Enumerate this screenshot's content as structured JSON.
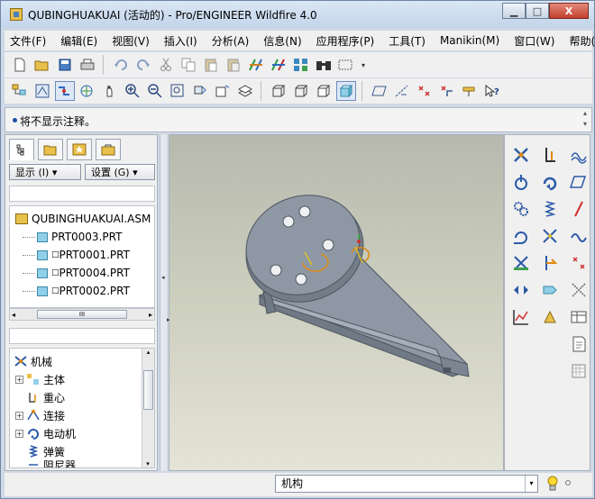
{
  "window": {
    "title": "QUBINGHUAKUAI (活动的) - Pro/ENGINEER Wildfire 4.0",
    "min_glyph": "▁",
    "max_glyph": "□",
    "close_glyph": "X"
  },
  "menu": [
    "文件(F)",
    "编辑(E)",
    "视图(V)",
    "插入(I)",
    "分析(A)",
    "信息(N)",
    "应用程序(P)",
    "工具(T)",
    "Manikin(M)",
    "窗口(W)",
    "帮助(H)"
  ],
  "message": {
    "text": "将不显示注释。"
  },
  "leftpanel": {
    "filters": {
      "show_label": "显示 (I) ▾",
      "settings_label": "设置 (G) ▾"
    },
    "model_tree": {
      "root": "QUBINGHUAKUAI.ASM",
      "children": [
        "PRT0003.PRT",
        "PRT0001.PRT",
        "PRT0004.PRT",
        "PRT0002.PRT"
      ],
      "child_prefix": [
        "",
        "□",
        "□",
        "□"
      ]
    },
    "hscroll_thumb": "III",
    "mechanism_tree": {
      "root": "机械",
      "items": [
        "主体",
        "重心",
        "连接",
        "电动机",
        "弹簧"
      ],
      "expandable": [
        "+",
        "",
        "+",
        "+",
        ""
      ],
      "truncated_item": "阻尼器"
    }
  },
  "status": {
    "mode": "机构"
  },
  "icons": {
    "toolbar1": [
      "new-icon",
      "open-icon",
      "save-icon",
      "print-icon",
      "undo-icon",
      "redo-icon",
      "cut-icon",
      "copy-icon",
      "paste-icon",
      "paste-special-icon",
      "regenerate-icon",
      "regen-manager-icon",
      "find-icon",
      "binoculars-icon",
      "select-box-icon"
    ],
    "toolbar2": [
      "model-tree-icon",
      "display-icon",
      "spin-center-icon",
      "orient-icon",
      "pan-icon",
      "zoom-in-icon",
      "zoom-out-icon",
      "refit-icon",
      "reorient-icon",
      "saved-views-icon",
      "layers-icon",
      "wireframe-icon",
      "hidden-line-icon",
      "no-hidden-icon",
      "shading-icon",
      "datum-planes-icon",
      "datum-axes-icon",
      "datum-points-icon",
      "coord-systems-icon",
      "annotations-icon",
      "whats-this-icon"
    ]
  },
  "colors": {
    "viewport_top": "#b7b9ae",
    "viewport_bottom": "#e4e4d6",
    "part_face": "#8e98a4",
    "part_dark": "#4d5660",
    "motion_orange": "#e08a10"
  }
}
